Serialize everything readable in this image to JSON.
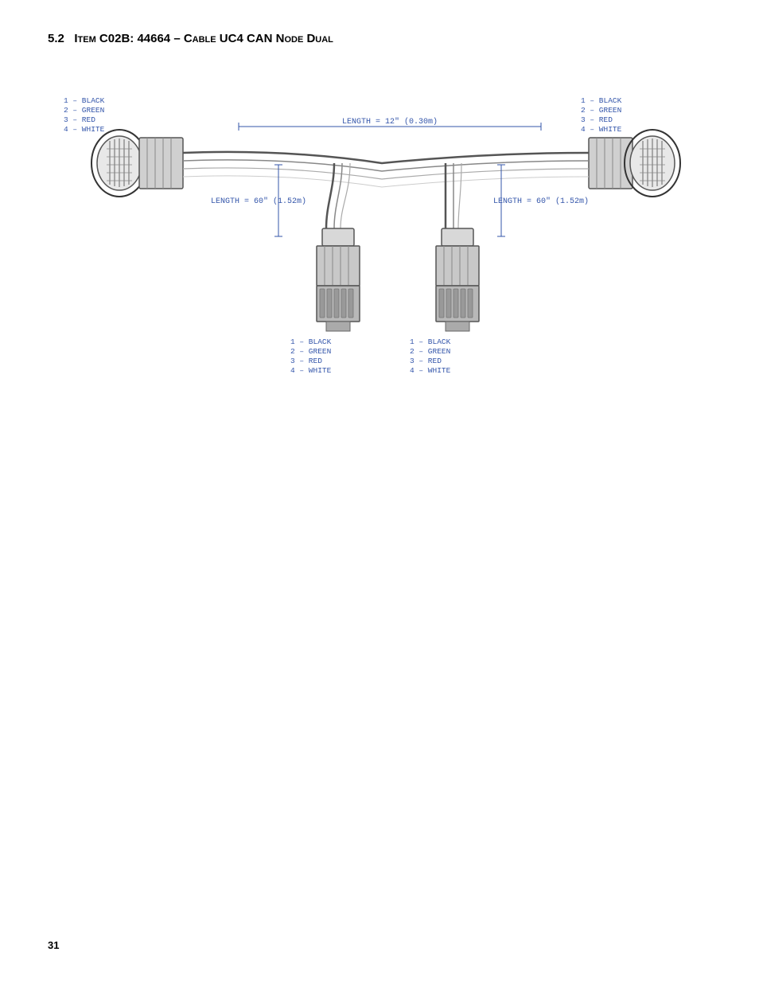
{
  "page": {
    "number": "31",
    "section": {
      "number": "5.2",
      "title": "Item C02B: 44664 – Cable UC4 CAN Node Dual"
    }
  },
  "diagram": {
    "length_center": "LENGTH = 12\" (0.30m)",
    "length_left": "LENGTH = 60\" (1.52m)",
    "length_right": "LENGTH = 60\" (1.52m)",
    "wire_labels_left_top": [
      "1 – BLACK",
      "2 – GREEN",
      "3 – RED",
      "4 – WHITE"
    ],
    "wire_labels_right_top": [
      "1 – BLACK",
      "2 – GREEN",
      "3 – RED",
      "4 – WHITE"
    ],
    "wire_labels_bottom_left": [
      "1 – BLACK",
      "2 – GREEN",
      "3 – RED",
      "4 – WHITE"
    ],
    "wire_labels_bottom_right": [
      "1 – BLACK",
      "2 – GREEN",
      "3 – RED",
      "4 – WHITE"
    ]
  }
}
